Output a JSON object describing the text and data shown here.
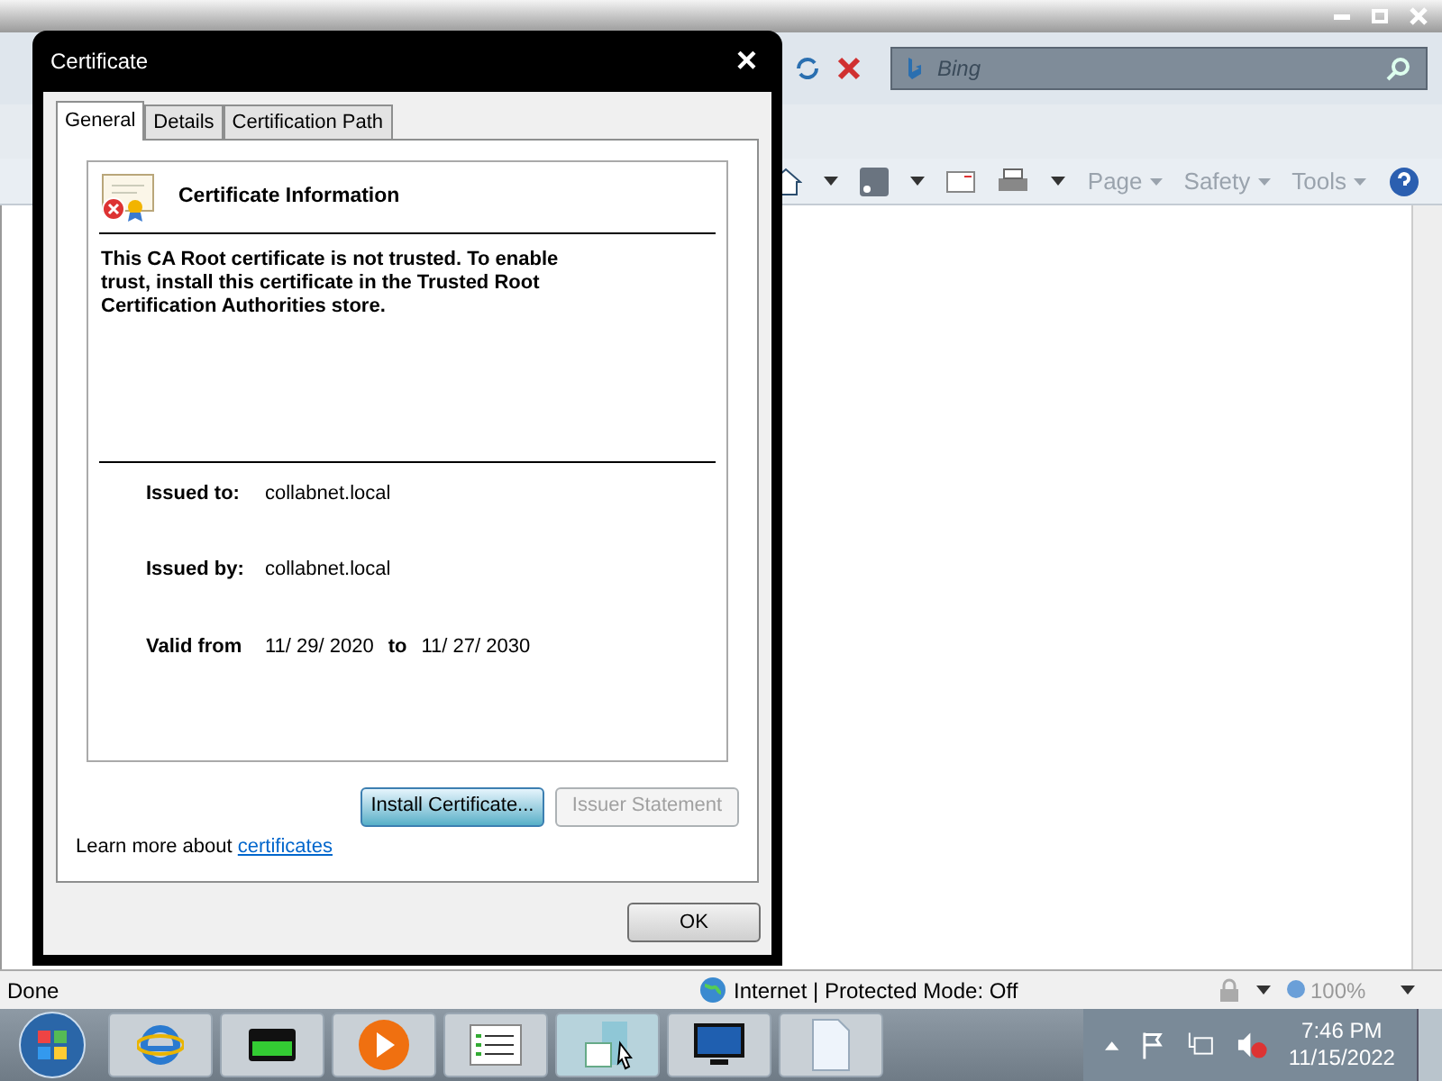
{
  "browser": {
    "search": {
      "placeholder": "Bing"
    },
    "commands": [
      {
        "label": "Page"
      },
      {
        "label": "Safety"
      },
      {
        "label": "Tools"
      }
    ]
  },
  "dialog": {
    "title": "Certificate",
    "close": "×",
    "tabs": [
      {
        "label": "General",
        "selected": true
      },
      {
        "label": "Details",
        "selected": false
      },
      {
        "label": "Certification Path",
        "selected": false
      }
    ],
    "heading": "Certificate Information",
    "message": "This CA Root certificate is not trusted. To enable trust, install this certificate in the Trusted Root Certification Authorities store.",
    "fields": [
      {
        "label": "Issued to:",
        "value": "collabnet.local"
      },
      {
        "label": "Issued by:",
        "value": "collabnet.local"
      }
    ],
    "validity": {
      "label": "Valid from",
      "from": "11/ 29/ 2020",
      "to_label": "to",
      "to": "11/ 27/ 2030"
    },
    "buttons": [
      {
        "label": "Install Certificate...",
        "disabled": false
      },
      {
        "label": "Issuer Statement",
        "disabled": true
      }
    ],
    "learn_more": {
      "text": "Learn more about",
      "link": "certificates"
    },
    "ok": "OK"
  },
  "status_bar": {
    "text": "Done",
    "zone": "Internet | Protected Mode: Off",
    "zoom": "100%"
  },
  "taskbar": {
    "time": "7:46 PM",
    "date": "11/15/2022"
  }
}
